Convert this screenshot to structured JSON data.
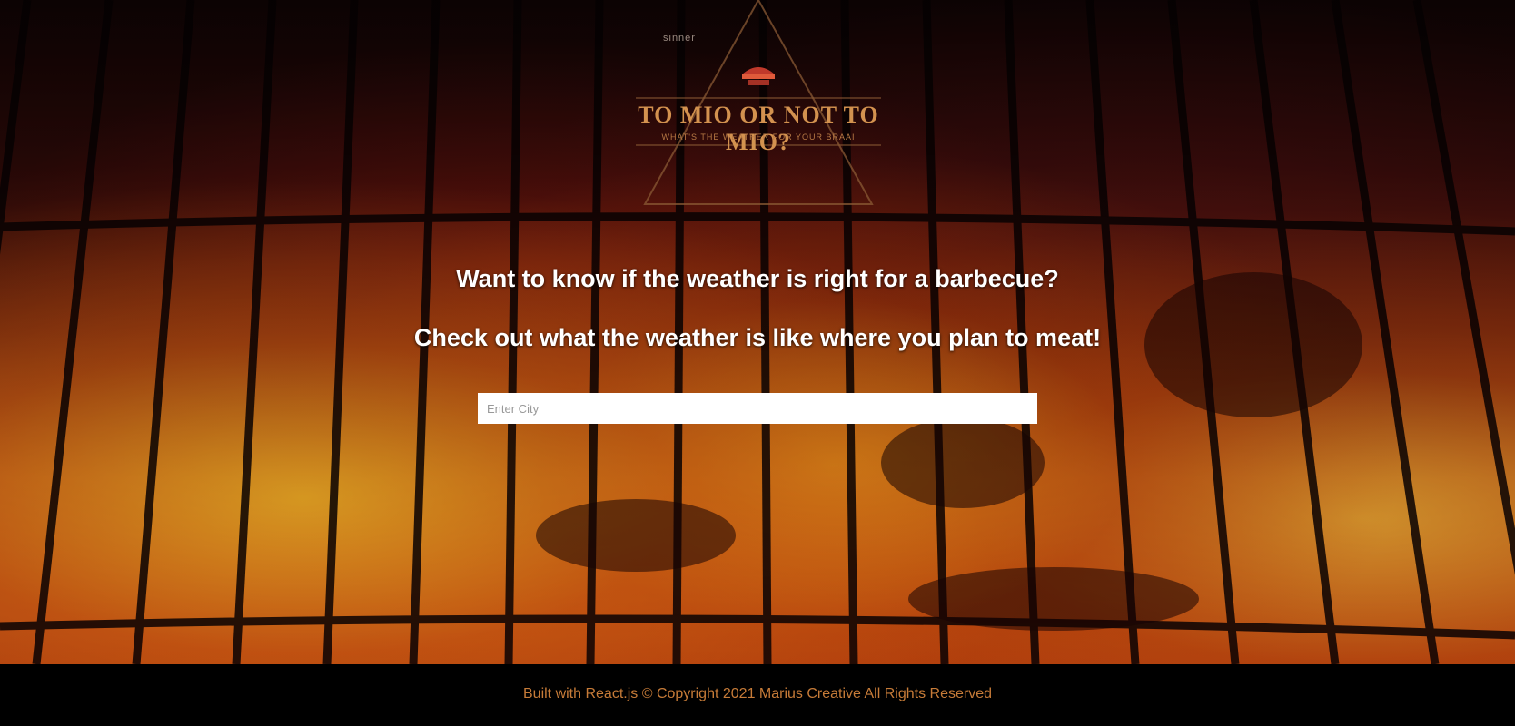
{
  "logo": {
    "top_text": "sinner",
    "title": "TO MIO OR NOT TO MIO?",
    "subtitle": "WHAT'S THE WEATHER FOR YOUR BRAAI"
  },
  "hero": {
    "headline": "Want to know if the weather is right for a barbecue?",
    "subline": "Check out what the weather is like where you plan to meat!"
  },
  "search": {
    "placeholder": "Enter City",
    "value": ""
  },
  "footer": {
    "text": "Built with React.js  © Copyright 2021 Marius Creative All Rights Reserved"
  },
  "colors": {
    "accent": "#d3924f",
    "footer_text": "#c67b38",
    "footer_bg": "#000000"
  }
}
